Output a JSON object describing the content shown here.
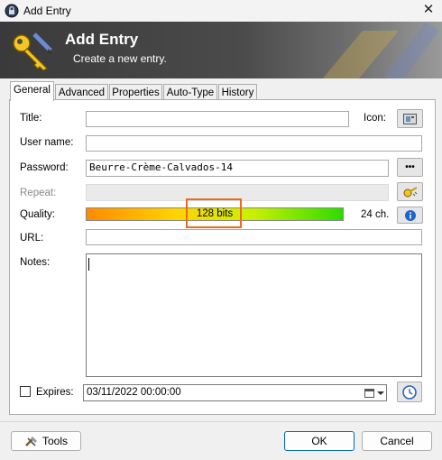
{
  "window": {
    "title": "Add Entry",
    "close_glyph": "✕"
  },
  "banner": {
    "title": "Add Entry",
    "subtitle": "Create a new entry.",
    "icon": "keys-icon"
  },
  "tabs": [
    {
      "label": "General",
      "active": true
    },
    {
      "label": "Advanced"
    },
    {
      "label": "Properties"
    },
    {
      "label": "Auto-Type"
    },
    {
      "label": "History"
    }
  ],
  "form": {
    "title_label": "Title:",
    "icon_label": "Icon:",
    "username_label": "User name:",
    "password_label": "Password:",
    "password_value": "Beurre-Crème-Calvados-14",
    "show_password_glyph": "•••",
    "repeat_label": "Repeat:",
    "quality_label": "Quality:",
    "quality_bits": "128 bits",
    "quality_chars": "24 ch.",
    "quality_fill": 1.0,
    "url_label": "URL:",
    "notes_label": "Notes:",
    "expires_label": "Expires:",
    "expires_checked": false,
    "expires_value": "03/11/2022 00:00:00"
  },
  "footer": {
    "tools_label": "Tools",
    "ok_label": "OK",
    "cancel_label": "Cancel"
  },
  "colors": {
    "highlight": "#ec6a1c",
    "info": "#1a66cc",
    "ok_border": "#0067c0"
  }
}
